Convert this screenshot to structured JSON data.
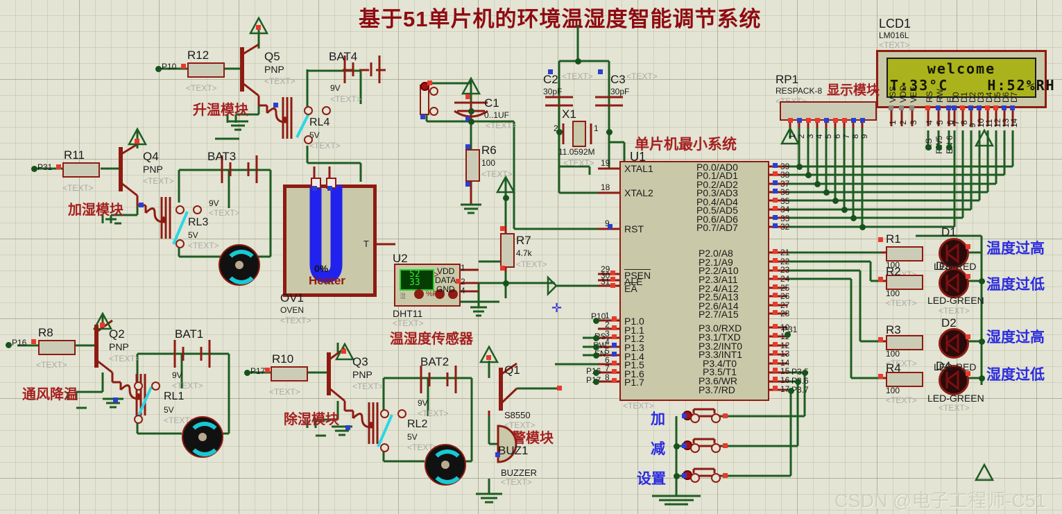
{
  "title": "基于51单片机的环境温湿度智能调节系统",
  "watermark": "CSDN @电子工程师-C51",
  "text_placeholder": "<TEXT>",
  "lcd": {
    "ref": "LCD1",
    "model": "LM016L",
    "line1": "welcome",
    "line2": "T:33°C    H:52%RH",
    "pins_top": [
      "VSS",
      "VDD",
      "VEE",
      "RS",
      "RW",
      "E",
      "D0",
      "D1",
      "D2",
      "D3",
      "D4",
      "D5",
      "D6",
      "D7"
    ],
    "pin_numbers": [
      "1",
      "2",
      "3",
      "4",
      "5",
      "6",
      "7",
      "8",
      "9",
      "10",
      "11",
      "12",
      "13",
      "14"
    ],
    "net_labels": [
      "RS",
      "RW5",
      "EN 6"
    ]
  },
  "respack": {
    "ref": "RP1",
    "model": "RESPACK-8",
    "pins": [
      "1",
      "2",
      "3",
      "4",
      "5",
      "6",
      "7",
      "8",
      "9"
    ],
    "caption": "显示模块"
  },
  "mcu": {
    "ref": "U1",
    "caption": "单片机最小系统",
    "left_pins": [
      {
        "num": "19",
        "name": "XTAL1"
      },
      {
        "num": "18",
        "name": "XTAL2"
      },
      {
        "num": "9",
        "name": "RST"
      },
      {
        "num": "29",
        "name": "PSEN"
      },
      {
        "num": "30",
        "name": "ALE"
      },
      {
        "num": "31",
        "name": "EA"
      },
      {
        "num": "1",
        "name": "P1.0",
        "net": "P10"
      },
      {
        "num": "2",
        "name": "P1.1",
        "net": ""
      },
      {
        "num": "3",
        "name": "P1.2",
        "net": "RS"
      },
      {
        "num": "4",
        "name": "P1.3",
        "net": "RW"
      },
      {
        "num": "5",
        "name": "P1.4",
        "net": "EN"
      },
      {
        "num": "6",
        "name": "P1.5",
        "net": ""
      },
      {
        "num": "7",
        "name": "P1.6",
        "net": "P16"
      },
      {
        "num": "8",
        "name": "P1.7",
        "net": "P17"
      }
    ],
    "p0_pins": [
      {
        "num": "39",
        "name": "P0.0/AD0"
      },
      {
        "num": "38",
        "name": "P0.1/AD1"
      },
      {
        "num": "37",
        "name": "P0.2/AD2"
      },
      {
        "num": "36",
        "name": "P0.3/AD3"
      },
      {
        "num": "35",
        "name": "P0.4/AD4"
      },
      {
        "num": "34",
        "name": "P0.5/AD5"
      },
      {
        "num": "33",
        "name": "P0.6/AD6"
      },
      {
        "num": "32",
        "name": "P0.7/AD7"
      }
    ],
    "p2_pins": [
      {
        "num": "21",
        "name": "P2.0/A8"
      },
      {
        "num": "22",
        "name": "P2.1/A9"
      },
      {
        "num": "23",
        "name": "P2.2/A10"
      },
      {
        "num": "24",
        "name": "P2.3/A11"
      },
      {
        "num": "25",
        "name": "P2.4/A12"
      },
      {
        "num": "26",
        "name": "P2.5/A13"
      },
      {
        "num": "27",
        "name": "P2.6/A14"
      },
      {
        "num": "28",
        "name": "P2.7/A15"
      }
    ],
    "p3_pins": [
      {
        "num": "10",
        "name": "P3.0/RXD",
        "net": ""
      },
      {
        "num": "11",
        "name": "P3.1/TXD",
        "net": "P31"
      },
      {
        "num": "12",
        "name": "P3.2/INT0",
        "net": ""
      },
      {
        "num": "13",
        "name": "P3.3/INT1",
        "net": ""
      },
      {
        "num": "14",
        "name": "P3.4/T0",
        "net": ""
      },
      {
        "num": "15",
        "name": "P3.5/T1",
        "net": "P3.5"
      },
      {
        "num": "16",
        "name": "P3.6/WR",
        "net": "P3.6"
      },
      {
        "num": "17",
        "name": "P3.7/RD",
        "net": "P3.7"
      }
    ]
  },
  "modules": {
    "heating": "升温模块",
    "humidify": "加湿模块",
    "ventilate": "通风降温",
    "dehumidify": "除湿模块",
    "alarm": "报警模块",
    "sensor": "温湿度传感器"
  },
  "indicators": [
    {
      "label": "温度过高"
    },
    {
      "label": "温度过低"
    },
    {
      "label": "湿度过高"
    },
    {
      "label": "湿度过低"
    }
  ],
  "buttons": [
    {
      "label": "加"
    },
    {
      "label": "减"
    },
    {
      "label": "设置"
    }
  ],
  "components": {
    "r12": {
      "ref": "R12",
      "net": "P10"
    },
    "r11": {
      "ref": "R11",
      "net": "P31"
    },
    "r8": {
      "ref": "R8",
      "net": "P16"
    },
    "r10": {
      "ref": "R10",
      "net": "P17"
    },
    "r6": {
      "ref": "R6",
      "value": "100"
    },
    "r7": {
      "ref": "R7",
      "value": "4.7k"
    },
    "r1": {
      "ref": "R1",
      "value": "100"
    },
    "r2": {
      "ref": "R2",
      "value": "100"
    },
    "r3": {
      "ref": "R3",
      "value": "100"
    },
    "r4": {
      "ref": "R4",
      "value": "100"
    },
    "c1": {
      "ref": "C1",
      "value": "0..1UF"
    },
    "c2": {
      "ref": "C2",
      "value": "30pF"
    },
    "c3": {
      "ref": "C3",
      "value": "30pF"
    },
    "x1": {
      "ref": "X1",
      "value": "11.0592M",
      "pin1": "1",
      "pin2": "2"
    },
    "q1": {
      "ref": "Q1",
      "model": "S8550"
    },
    "q2": {
      "ref": "Q2",
      "model": "PNP"
    },
    "q3": {
      "ref": "Q3",
      "model": "PNP"
    },
    "q4": {
      "ref": "Q4",
      "model": "PNP"
    },
    "q5": {
      "ref": "Q5",
      "model": "PNP"
    },
    "bat1": {
      "ref": "BAT1",
      "value": "9V"
    },
    "bat2": {
      "ref": "BAT2",
      "value": "9V"
    },
    "bat3": {
      "ref": "BAT3",
      "value": "9V"
    },
    "bat4": {
      "ref": "BAT4",
      "value": "9V"
    },
    "rl1": {
      "ref": "RL1",
      "value": "5V"
    },
    "rl2": {
      "ref": "RL2",
      "value": "5V"
    },
    "rl3": {
      "ref": "RL3",
      "value": "5V"
    },
    "rl4": {
      "ref": "RL4",
      "value": "5V"
    },
    "ov1": {
      "ref": "OV1",
      "model": "OVEN",
      "heater": "Heater",
      "percent": "0%",
      "tpin": "T"
    },
    "u2": {
      "ref": "U2",
      "model": "DHT11",
      "disp1": "52",
      "disp2": "33",
      "unit": "%RH",
      "pins": [
        {
          "num": "1",
          "name": "VDD"
        },
        {
          "num": "2",
          "name": "DATA"
        },
        {
          "num": "4",
          "name": "GND"
        }
      ]
    },
    "buz1": {
      "ref": "BUZ1",
      "model": "BUZZER"
    },
    "d1": {
      "ref": "D1",
      "model": "LED-RED"
    },
    "d3": {
      "ref": "D3",
      "model": "LED-GREEN"
    },
    "d2": {
      "ref": "D2",
      "model": "LED-RED"
    },
    "d4": {
      "ref": "D4",
      "model": "LED-GREEN"
    }
  },
  "colors": {
    "wire": "#1d5c22",
    "part": "#8e1b12",
    "title": "#8e0b12",
    "module_caption": "#a52020",
    "indicator": "#2b2be0",
    "lcd_screen": "#aab31b",
    "background": "#e3e4d3"
  }
}
